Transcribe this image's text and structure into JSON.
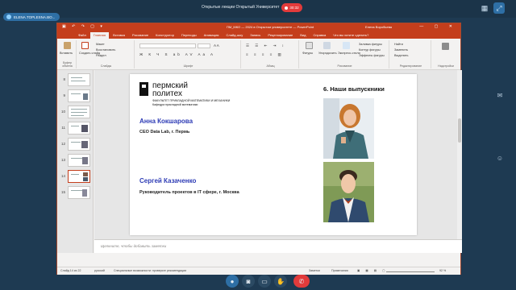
{
  "conference": {
    "participant_label": "ELENA.TOPLESNA.BO...",
    "session_title": "Открытые лекции Открытый Университет",
    "timer": "30:32",
    "controls": [
      "mic-icon",
      "camera-icon",
      "share-screen-icon",
      "hand-icon",
      "leave-icon"
    ]
  },
  "ppt": {
    "window_title": "ПМ_МКО — 2024 в Открытом университете  —  PowerPoint",
    "user_name": "Елена Воробьева",
    "tabs": [
      "Файл",
      "Главная",
      "Вставка",
      "Рисование",
      "Конструктор",
      "Переходы",
      "Анимация",
      "Слайд-шоу",
      "Запись",
      "Рецензирование",
      "Вид",
      "Справка"
    ],
    "tell_me": "Что вы хотите сделать?",
    "ribbon": {
      "clipboard": {
        "paste": "Вставить",
        "label": "Буфер обмена"
      },
      "slides": {
        "new_slide": "Создать слайд",
        "layout": "Макет",
        "reset": "Восстановить",
        "section": "Раздел",
        "label": "Слайды"
      },
      "font": {
        "label": "Шрифт"
      },
      "paragraph": {
        "label": "Абзац"
      },
      "drawing": {
        "shapes": "Фигуры",
        "arrange": "Упорядочить",
        "quick_styles": "Экспресс-стили",
        "fill": "Заливка фигуры",
        "outline": "Контур фигуры",
        "effects": "Эффекты фигуры",
        "label": "Рисование"
      },
      "editing": {
        "find": "Найти",
        "replace": "Заменить",
        "select": "Выделить",
        "label": "Редактирование"
      },
      "addins": {
        "label": "Надстройки"
      }
    },
    "thumbnails": [
      "8",
      "9",
      "10",
      "11",
      "12",
      "13",
      "14",
      "15"
    ],
    "selected_thumbnail": "14",
    "notes_placeholder": "Щелкните, чтобы добавить заметки",
    "status": {
      "slide_counter": "Слайд 14 из 22",
      "language": "русский",
      "accessibility": "Специальные возможности: проверьте рекомендации",
      "notes": "Заметки",
      "comments": "Примечания",
      "zoom": "92 %"
    }
  },
  "slide": {
    "logo_line1": "пермский",
    "logo_line2": "политех",
    "faculty": "ФАКУЛЬТЕТ ПРИКЛАДНОЙ МАТЕМАТИКИ И МЕХАНИКИ",
    "department": "Кафедра прикладной математики",
    "title": "6. Наши выпускники",
    "graduates": [
      {
        "name": "Анна Кокшарова",
        "role": "CEO Data Lab, г. Пермь"
      },
      {
        "name": "Сергей Казаченко",
        "role": "Руководитель проектов в IT сфере, г. Москва"
      }
    ]
  }
}
